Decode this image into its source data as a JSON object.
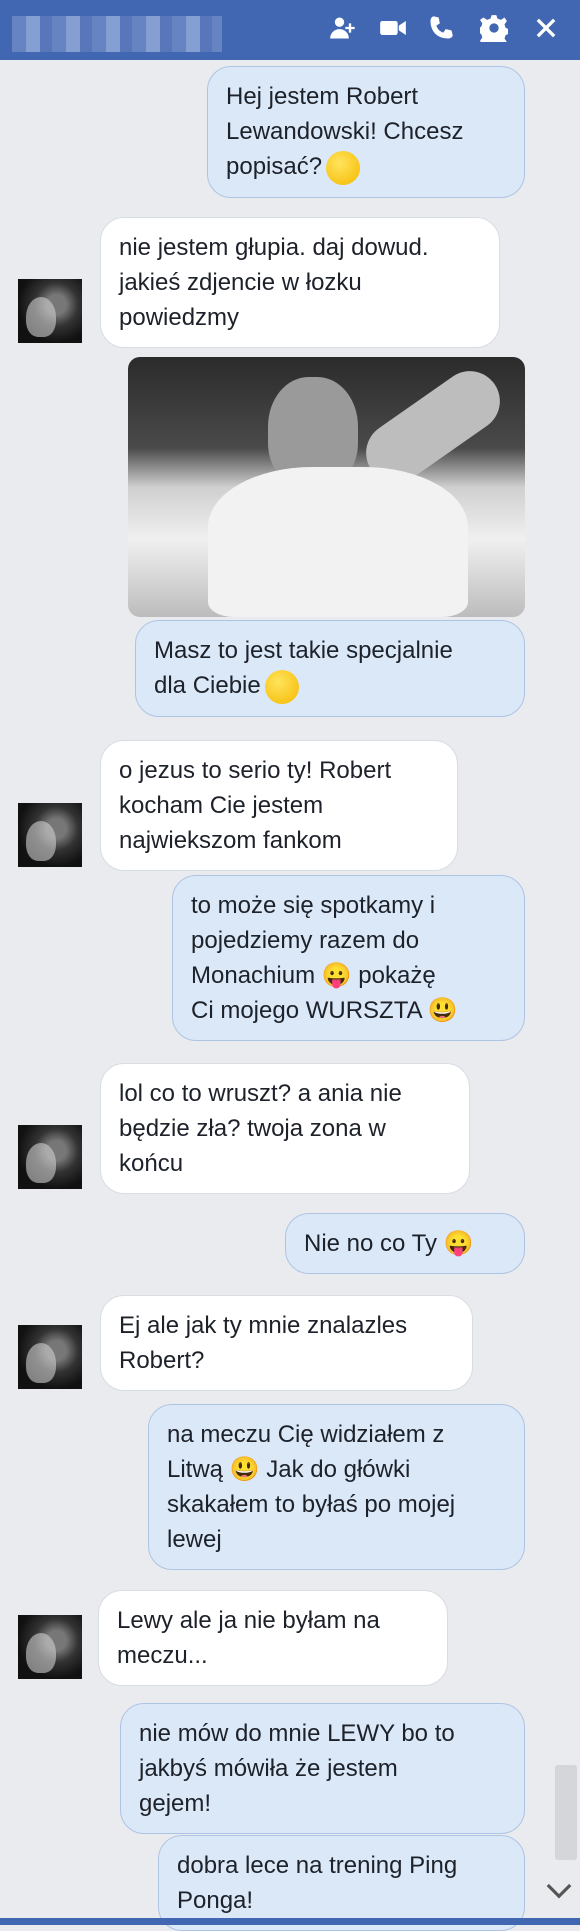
{
  "header": {
    "actions": [
      {
        "name": "add-person-icon"
      },
      {
        "name": "video-call-icon"
      },
      {
        "name": "phone-call-icon"
      },
      {
        "name": "gear-icon"
      },
      {
        "name": "close-icon"
      }
    ]
  },
  "messages": [
    {
      "dir": "out",
      "lines": [
        "Hej jestem Robert",
        "Lewandowski! Chcesz",
        "popisać?"
      ],
      "emoji": "tongue"
    },
    {
      "dir": "in",
      "lines": [
        "nie jestem głupia. daj dowud.",
        "jakieś zdjencie w łozku",
        "powiedzmy"
      ]
    },
    {
      "dir": "out",
      "lines": [
        "Masz to jest takie specjalnie",
        "dla Ciebie"
      ],
      "emoji": "kiss"
    },
    {
      "dir": "in",
      "lines": [
        "o jezus to serio ty! Robert",
        "kocham Cie jestem",
        "najwiekszom fankom"
      ]
    },
    {
      "dir": "out",
      "lines": [
        "to może się spotkamy i",
        "pojedziemy razem do",
        "Monachium 😛 pokażę",
        "Ci mojego WURSZTA 😃"
      ]
    },
    {
      "dir": "in",
      "lines": [
        "lol co to wruszt? a ania nie",
        "będzie zła? twoja zona w",
        "końcu"
      ]
    },
    {
      "dir": "out",
      "lines": [
        "Nie no co Ty 😛"
      ]
    },
    {
      "dir": "in",
      "lines": [
        "Ej ale jak ty mnie znalazles",
        "Robert?"
      ]
    },
    {
      "dir": "out",
      "lines": [
        "na meczu Cię widziałem z",
        "Litwą 😃 Jak do główki",
        "skakałem to byłaś po mojej",
        "lewej"
      ]
    },
    {
      "dir": "in",
      "lines": [
        "Lewy ale ja nie byłam na",
        "meczu..."
      ]
    },
    {
      "dir": "out",
      "lines": [
        "nie mów do mnie LEWY bo to",
        "jakbyś mówiła że jestem",
        "gejem!"
      ]
    },
    {
      "dir": "out",
      "lines": [
        "dobra lece na trening Ping",
        "Ponga!"
      ]
    }
  ],
  "colors": {
    "header": "#4267b2",
    "outgoing": "#dbe8f8",
    "incoming": "#ffffff",
    "background": "#e9ebee"
  }
}
